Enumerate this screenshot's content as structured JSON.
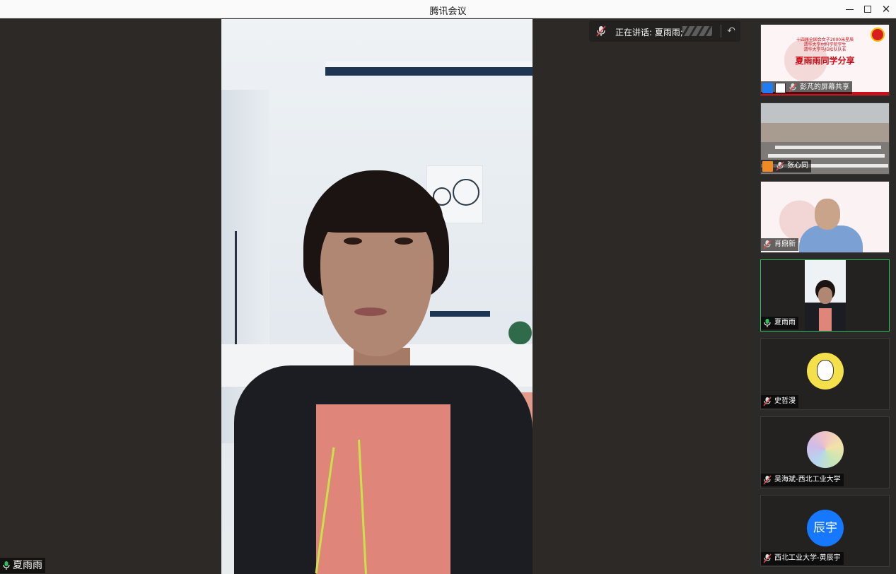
{
  "window": {
    "title": "腾讯会议",
    "controls": {
      "minimize": "minimize-icon",
      "maximize": "maximize-icon",
      "close": "close-icon"
    }
  },
  "speaking": {
    "label": "正在讲话: 夏雨雨;"
  },
  "main_video": {
    "name": "夏雨雨"
  },
  "participants": [
    {
      "name": "彭芃的屏幕共享",
      "type": "screen-share",
      "slide_small_lines": [
        "十四届全国会女子2000米星辰",
        "清华大学材料学院学生",
        "清华大学马拉松队队长"
      ],
      "slide_title": "夏雨雨同学分享"
    },
    {
      "name": "张心同",
      "type": "video-classroom"
    },
    {
      "name": "肖鼎新",
      "type": "video-lecture"
    },
    {
      "name": "夏雨雨",
      "type": "video-active"
    },
    {
      "name": "史哲漫",
      "type": "avatar"
    },
    {
      "name": "吴海斌-西北工业大学",
      "type": "avatar"
    },
    {
      "name": "西北工业大学-黄辰宇",
      "type": "avatar",
      "avatar_text": "辰宇"
    }
  ],
  "colors": {
    "active_border": "#2fbf5c",
    "stage_bg": "#2d2926",
    "avatar_blue": "#1677ff"
  }
}
